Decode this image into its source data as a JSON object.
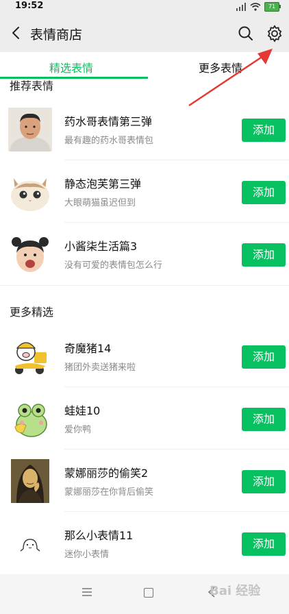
{
  "status_bar": {
    "time": "19:52",
    "battery": "71"
  },
  "header": {
    "title": "表情商店"
  },
  "tabs": [
    {
      "label": "精选表情"
    },
    {
      "label": "更多表情"
    }
  ],
  "sections": [
    {
      "title": "推荐表情",
      "items": [
        {
          "name": "药水哥表情第三弹",
          "desc": "最有趣的药水哥表情包",
          "button": "添加"
        },
        {
          "name": "静态泡芙第三弹",
          "desc": "大眼萌猫虽迟但到",
          "button": "添加"
        },
        {
          "name": "小酱柒生活篇3",
          "desc": "没有可爱的表情包怎么行",
          "button": "添加"
        }
      ]
    },
    {
      "title": "更多精选",
      "items": [
        {
          "name": "奇魔猪14",
          "desc": "猪团外卖送猪来啦",
          "button": "添加"
        },
        {
          "name": "蛙娃10",
          "desc": "爱你鸭",
          "button": "添加"
        },
        {
          "name": "蒙娜丽莎的偷笑2",
          "desc": "蒙娜丽莎在你背后偷笑",
          "button": "添加"
        },
        {
          "name": "那么小表情11",
          "desc": "迷你小表情",
          "button": "添加"
        }
      ]
    }
  ],
  "watermark": "Bai 经验",
  "colors": {
    "accent": "#07c160",
    "annotation_arrow": "#e53935"
  }
}
